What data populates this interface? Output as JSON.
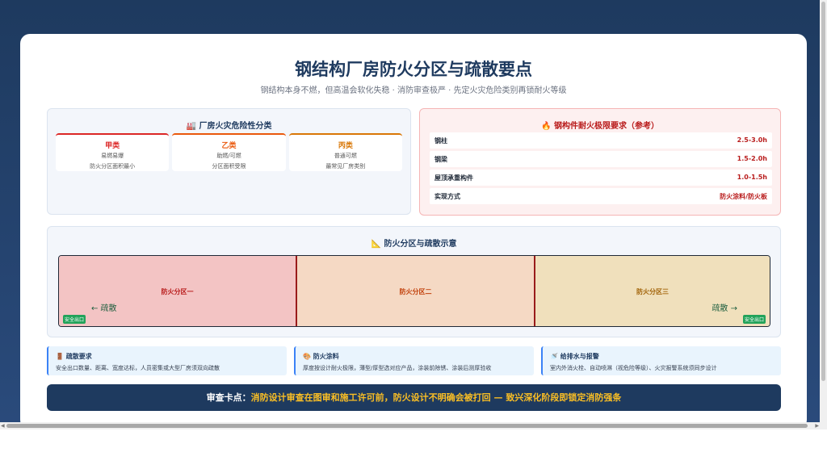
{
  "header": {
    "title": "钢结构厂房防火分区与疏散要点",
    "subtitle": "钢结构本身不燃，但高温会软化失稳 · 消防审查极严 · 先定火灾危险类别再锁耐火等级"
  },
  "hazard": {
    "heading": "🏭 厂房火灾危险性分类",
    "items": [
      {
        "name": "甲类",
        "line1": "易燃易爆",
        "line2": "防火分区面积最小",
        "color": "#dc2626"
      },
      {
        "name": "乙类",
        "line1": "助燃/可燃",
        "line2": "分区面积受限",
        "color": "#ea580c"
      },
      {
        "name": "丙类",
        "line1": "普通可燃",
        "line2": "最常见厂房类别",
        "color": "#d97706"
      }
    ]
  },
  "rating": {
    "heading": "🔥 钢构件耐火极限要求（参考）",
    "rows": [
      {
        "label": "钢柱",
        "value": "2.5-3.0h"
      },
      {
        "label": "钢梁",
        "value": "1.5-2.0h"
      },
      {
        "label": "屋顶承重构件",
        "value": "1.0-1.5h"
      },
      {
        "label": "实现方式",
        "value": "防火涂料/防火板"
      }
    ]
  },
  "zones": {
    "heading": "📐 防火分区与疏散示意",
    "items": [
      {
        "label": "防火分区一",
        "bg": "#f3c4c4",
        "color": "#b91c1c"
      },
      {
        "label": "防火分区二",
        "bg": "#f5d9c4",
        "color": "#c2410c"
      },
      {
        "label": "防火分区三",
        "bg": "#f0e0bc",
        "color": "#a16207"
      }
    ],
    "evac_left": "← 疏散",
    "evac_right": "疏散 →",
    "exit_left": "安全出口",
    "exit_right": "安全出口"
  },
  "info": [
    {
      "title": "🚪 疏散要求",
      "text": "安全出口数量、距离、宽度达标，人员密集或大型厂房须双向疏散"
    },
    {
      "title": "🎨 防火涂料",
      "text": "厚度按设计耐火极限，薄型/厚型选对应产品，涂装前除锈、涂装后测厚验收"
    },
    {
      "title": "🚿 给排水与报警",
      "text": "室内外消火栓、自动喷淋（视危险等级）、火灾报警系统须同步设计"
    }
  ],
  "banner": {
    "key": "审查卡点：",
    "msg": "消防设计审查在图审和施工许可前，防火设计不明确会被打回 — 致兴深化阶段即锁定消防强条"
  }
}
